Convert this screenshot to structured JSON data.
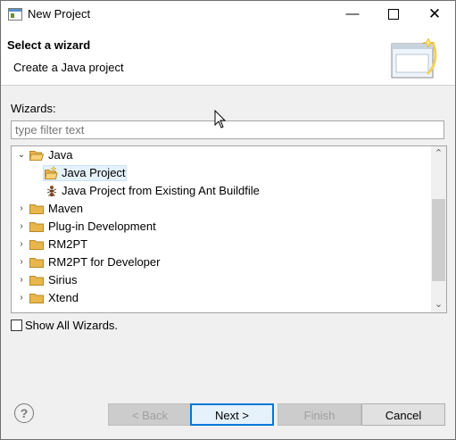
{
  "window": {
    "title": "New Project"
  },
  "header": {
    "title": "Select a wizard",
    "description": "Create a Java project"
  },
  "filter": {
    "label": "Wizards:",
    "placeholder": "type filter text",
    "value": ""
  },
  "tree": {
    "items": [
      {
        "label": "Java",
        "type": "folder",
        "expanded": true,
        "level": 0
      },
      {
        "label": "Java Project",
        "type": "wizard",
        "selected": true,
        "level": 1
      },
      {
        "label": "Java Project from Existing Ant Buildfile",
        "type": "wizard",
        "level": 1
      },
      {
        "label": "Maven",
        "type": "folder",
        "expanded": false,
        "level": 0
      },
      {
        "label": "Plug-in Development",
        "type": "folder",
        "expanded": false,
        "level": 0
      },
      {
        "label": "RM2PT",
        "type": "folder",
        "expanded": false,
        "level": 0
      },
      {
        "label": "RM2PT for Developer",
        "type": "folder",
        "expanded": false,
        "level": 0
      },
      {
        "label": "Sirius",
        "type": "folder",
        "expanded": false,
        "level": 0
      },
      {
        "label": "Xtend",
        "type": "folder",
        "expanded": false,
        "level": 0
      }
    ]
  },
  "show_all": {
    "label": "Show All Wizards.",
    "checked": false
  },
  "buttons": {
    "back": "< Back",
    "next": "Next >",
    "finish": "Finish",
    "cancel": "Cancel",
    "help": "?"
  },
  "colors": {
    "folder": "#e8b64c",
    "selection": "#e5f1fb",
    "accent": "#0078d7"
  }
}
